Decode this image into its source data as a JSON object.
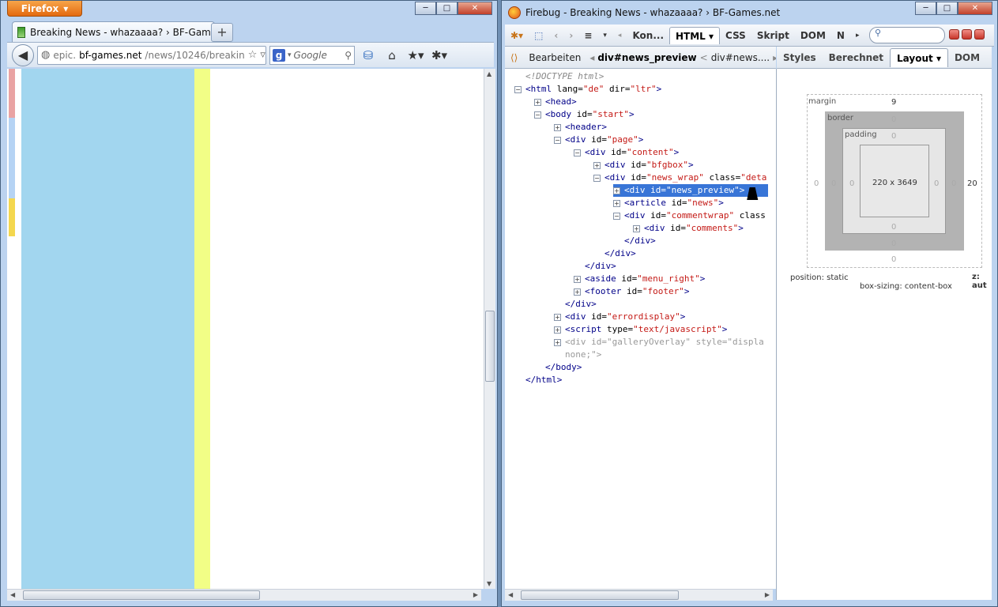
{
  "firefox": {
    "menu_button": "Firefox",
    "tab_title": "Breaking News - whazaaaa? › BF-Games....",
    "new_tab_symbol": "+",
    "url_gray_prefix": "epic.",
    "url_domain": "bf-games.net",
    "url_path": "/news/10246/breakin",
    "search_placeholder": "Google",
    "caption_minimize": "─",
    "caption_maximize": "□",
    "caption_close": "✕"
  },
  "firebug": {
    "window_title": "Firebug - Breaking News - whazaaaa? › BF-Games.net",
    "toolbar_tabs": [
      "Kon...",
      "HTML",
      "CSS",
      "Skript",
      "DOM",
      "N"
    ],
    "selected_tab": "HTML",
    "breadcrumb": {
      "edit_label": "Bearbeiten",
      "current": "div#news_preview",
      "separator": "<",
      "parent": "div#news...."
    },
    "side_tabs": [
      "Styles",
      "Berechnet",
      "Layout",
      "DOM"
    ],
    "selected_side_tab": "Layout",
    "tree": [
      {
        "indent": 0,
        "toggle": "",
        "parts": [
          [
            "cm",
            "<!DOCTYPE html>"
          ]
        ]
      },
      {
        "indent": 0,
        "toggle": "−",
        "parts": [
          [
            "tg",
            "<html "
          ],
          [
            "at",
            "lang="
          ],
          [
            "av",
            "\"de\""
          ],
          [
            "at",
            " dir="
          ],
          [
            "av",
            "\"ltr\""
          ],
          [
            "tg",
            ">"
          ]
        ]
      },
      {
        "indent": 1,
        "toggle": "+",
        "parts": [
          [
            "tg",
            "<head>"
          ]
        ]
      },
      {
        "indent": 1,
        "toggle": "−",
        "parts": [
          [
            "tg",
            "<body "
          ],
          [
            "at",
            "id="
          ],
          [
            "av",
            "\"start\""
          ],
          [
            "tg",
            ">"
          ]
        ]
      },
      {
        "indent": 2,
        "toggle": "+",
        "parts": [
          [
            "tg",
            "<header>"
          ]
        ]
      },
      {
        "indent": 2,
        "toggle": "−",
        "parts": [
          [
            "tg",
            "<div "
          ],
          [
            "at",
            "id="
          ],
          [
            "av",
            "\"page\""
          ],
          [
            "tg",
            ">"
          ]
        ]
      },
      {
        "indent": 3,
        "toggle": "−",
        "parts": [
          [
            "tg",
            "<div "
          ],
          [
            "at",
            "id="
          ],
          [
            "av",
            "\"content\""
          ],
          [
            "tg",
            ">"
          ]
        ]
      },
      {
        "indent": 4,
        "toggle": "+",
        "parts": [
          [
            "tg",
            "<div "
          ],
          [
            "at",
            "id="
          ],
          [
            "av",
            "\"bfgbox\""
          ],
          [
            "tg",
            ">"
          ]
        ]
      },
      {
        "indent": 4,
        "toggle": "−",
        "parts": [
          [
            "tg",
            "<div "
          ],
          [
            "at",
            "id="
          ],
          [
            "av",
            "\"news_wrap\""
          ],
          [
            "at",
            " class="
          ],
          [
            "av",
            "\"deta"
          ]
        ]
      },
      {
        "indent": 5,
        "toggle": "+",
        "selected": true,
        "parts": [
          [
            "tg",
            "<div "
          ],
          [
            "at",
            "id="
          ],
          [
            "av",
            "\"news_preview\""
          ],
          [
            "tg",
            ">"
          ]
        ]
      },
      {
        "indent": 5,
        "toggle": "+",
        "parts": [
          [
            "tg",
            "<article "
          ],
          [
            "at",
            "id="
          ],
          [
            "av",
            "\"news\""
          ],
          [
            "tg",
            ">"
          ]
        ]
      },
      {
        "indent": 5,
        "toggle": "−",
        "parts": [
          [
            "tg",
            "<div "
          ],
          [
            "at",
            "id="
          ],
          [
            "av",
            "\"commentwrap\""
          ],
          [
            "at",
            " class"
          ]
        ]
      },
      {
        "indent": 6,
        "toggle": "+",
        "parts": [
          [
            "tg",
            "<div "
          ],
          [
            "at",
            "id="
          ],
          [
            "av",
            "\"comments\""
          ],
          [
            "tg",
            ">"
          ]
        ]
      },
      {
        "indent": 5,
        "toggle": "",
        "parts": [
          [
            "tg",
            "</div>"
          ]
        ]
      },
      {
        "indent": 4,
        "toggle": "",
        "parts": [
          [
            "tg",
            "</div>"
          ]
        ]
      },
      {
        "indent": 3,
        "toggle": "",
        "parts": [
          [
            "tg",
            "</div>"
          ]
        ]
      },
      {
        "indent": 3,
        "toggle": "+",
        "parts": [
          [
            "tg",
            "<aside "
          ],
          [
            "at",
            "id="
          ],
          [
            "av",
            "\"menu_right\""
          ],
          [
            "tg",
            ">"
          ]
        ]
      },
      {
        "indent": 3,
        "toggle": "+",
        "parts": [
          [
            "tg",
            "<footer "
          ],
          [
            "at",
            "id="
          ],
          [
            "av",
            "\"footer\""
          ],
          [
            "tg",
            ">"
          ]
        ]
      },
      {
        "indent": 2,
        "toggle": "",
        "parts": [
          [
            "tg",
            "</div>"
          ]
        ]
      },
      {
        "indent": 2,
        "toggle": "+",
        "parts": [
          [
            "tg",
            "<div "
          ],
          [
            "at",
            "id="
          ],
          [
            "av",
            "\"errordisplay\""
          ],
          [
            "tg",
            ">"
          ]
        ]
      },
      {
        "indent": 2,
        "toggle": "+",
        "parts": [
          [
            "tg",
            "<script "
          ],
          [
            "at",
            "type="
          ],
          [
            "av",
            "\"text/javascript\""
          ],
          [
            "tg",
            ">"
          ]
        ]
      },
      {
        "indent": 2,
        "toggle": "+",
        "parts": [
          [
            "dim",
            "<div "
          ],
          [
            "dim",
            "id="
          ],
          [
            "dim",
            "\"galleryOverlay\""
          ],
          [
            "dim",
            " style="
          ],
          [
            "dim",
            "\"displa"
          ]
        ]
      },
      {
        "indent": 2,
        "toggle": "",
        "cont": true,
        "parts": [
          [
            "dim",
            "none;\">"
          ]
        ]
      },
      {
        "indent": 1,
        "toggle": "",
        "parts": [
          [
            "tg",
            "</body>"
          ]
        ]
      },
      {
        "indent": 0,
        "toggle": "",
        "parts": [
          [
            "tg",
            "</html>"
          ]
        ]
      }
    ],
    "layout": {
      "margin_label": "margin",
      "border_label": "border",
      "padding_label": "padding",
      "margin_top": "9",
      "margin_left": "0",
      "margin_right": "20",
      "margin_bottom": "0",
      "border_top": "0",
      "border_left": "0",
      "border_right": "0",
      "border_bottom": "0",
      "padding_top": "0",
      "padding_left": "0",
      "padding_right": "0",
      "padding_bottom": "0",
      "content_size": "220 x 3649",
      "position": "position: static",
      "box_sizing": "box-sizing: content-box",
      "z_index": "z: aut"
    }
  }
}
